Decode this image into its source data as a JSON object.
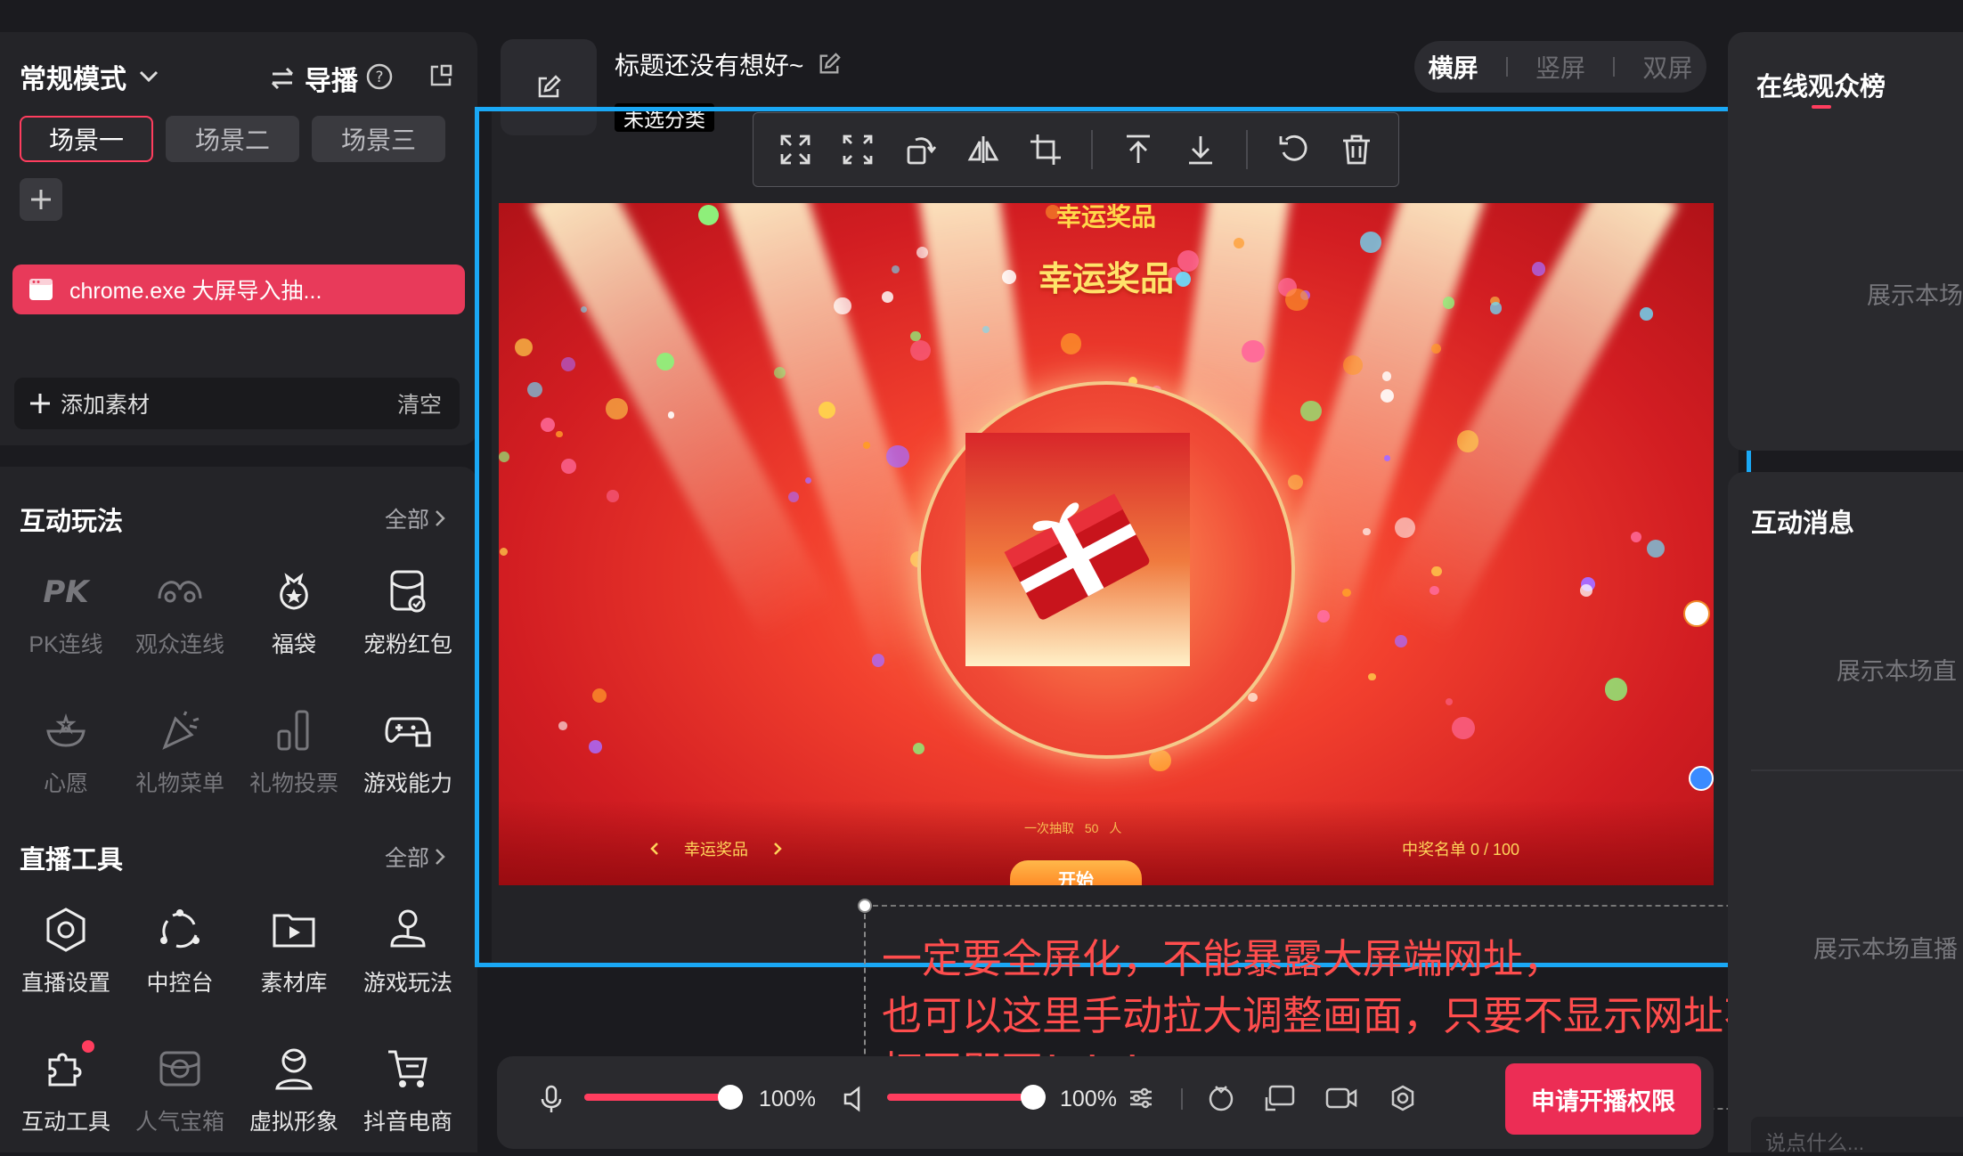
{
  "left": {
    "mode_label": "常规模式",
    "director_label": "导播",
    "scenes": [
      "场景一",
      "场景二",
      "场景三"
    ],
    "source_item": "chrome.exe 大屏导入抽...",
    "add_material": "添加素材",
    "clear": "清空",
    "interactive": {
      "title": "互动玩法",
      "all": "全部",
      "items": [
        "PK连线",
        "观众连线",
        "福袋",
        "宠粉红包",
        "心愿",
        "礼物菜单",
        "礼物投票",
        "游戏能力"
      ]
    },
    "tools": {
      "title": "直播工具",
      "all": "全部",
      "items": [
        "直播设置",
        "中控台",
        "素材库",
        "游戏玩法",
        "互动工具",
        "人气宝箱",
        "虚拟形象",
        "抖音电商"
      ]
    }
  },
  "center": {
    "stream_title": "标题还没有想好~",
    "category": "未选分类",
    "orientation": [
      "横屏",
      "竖屏",
      "双屏"
    ],
    "preview": {
      "banner_top": "幸运奖品",
      "title": "幸运奖品",
      "draw_prefix": "一次抽取",
      "draw_count": "50",
      "draw_unit": "人",
      "prize_nav": "幸运奖品",
      "winners": "中奖名单  0  /  100",
      "start": "开始"
    },
    "annotation": [
      "一定要全屏化，不能暴露大屏端网址，",
      "也可以这里手动拉大调整画面，只要不显示网址不被他人",
      "打开即可！！！"
    ]
  },
  "controls": {
    "mic_volume": "100%",
    "speaker_volume": "100%",
    "mic_level": 0.93,
    "speaker_level": 0.93,
    "apply_button": "申请开播权限"
  },
  "right": {
    "viewers_title": "在线观众榜",
    "viewers_tip": "展示本场",
    "messages_title": "互动消息",
    "messages_tip1": "展示本场直",
    "messages_tip2": "展示本场直播",
    "chat_placeholder": "说点什么..."
  },
  "colors": {
    "accent": "#ec2d55",
    "selection": "#1aa8f5",
    "annotation": "#ff4d4d"
  }
}
